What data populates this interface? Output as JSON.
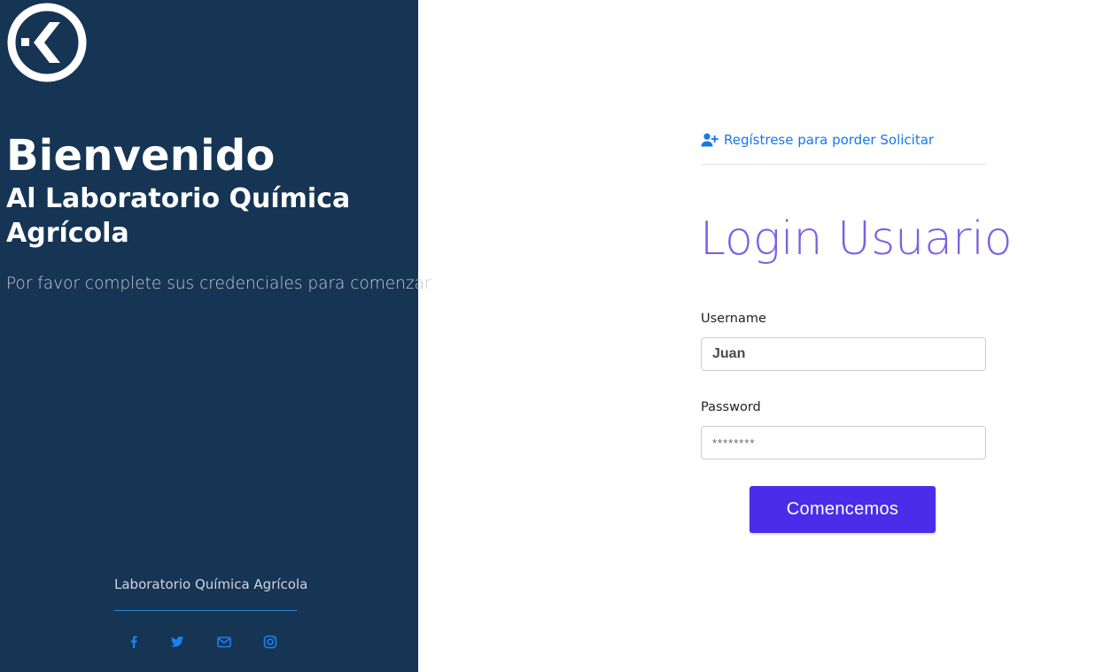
{
  "left_panel": {
    "welcome_title": "Bienvenido",
    "welcome_subtitle": "Al Laboratorio Química Agrícola",
    "welcome_text": "Por favor complete sus credenciales para comenzar",
    "footer_name": "Laboratorio Química Agrícola",
    "social_icons": [
      "facebook-icon",
      "twitter-icon",
      "email-icon",
      "instagram-icon"
    ],
    "background_color": "#163454"
  },
  "register": {
    "icon": "user-plus-icon",
    "label": "Regístrese para porder Solicitar"
  },
  "form": {
    "title": "Login Usuario",
    "username_label": "Username",
    "username_value": "Juan",
    "password_label": "Password",
    "password_value": "********",
    "submit_label": "Comencemos"
  },
  "colors": {
    "accent": "#4b2de9",
    "title": "#7b61e6",
    "link": "#1877e8"
  }
}
